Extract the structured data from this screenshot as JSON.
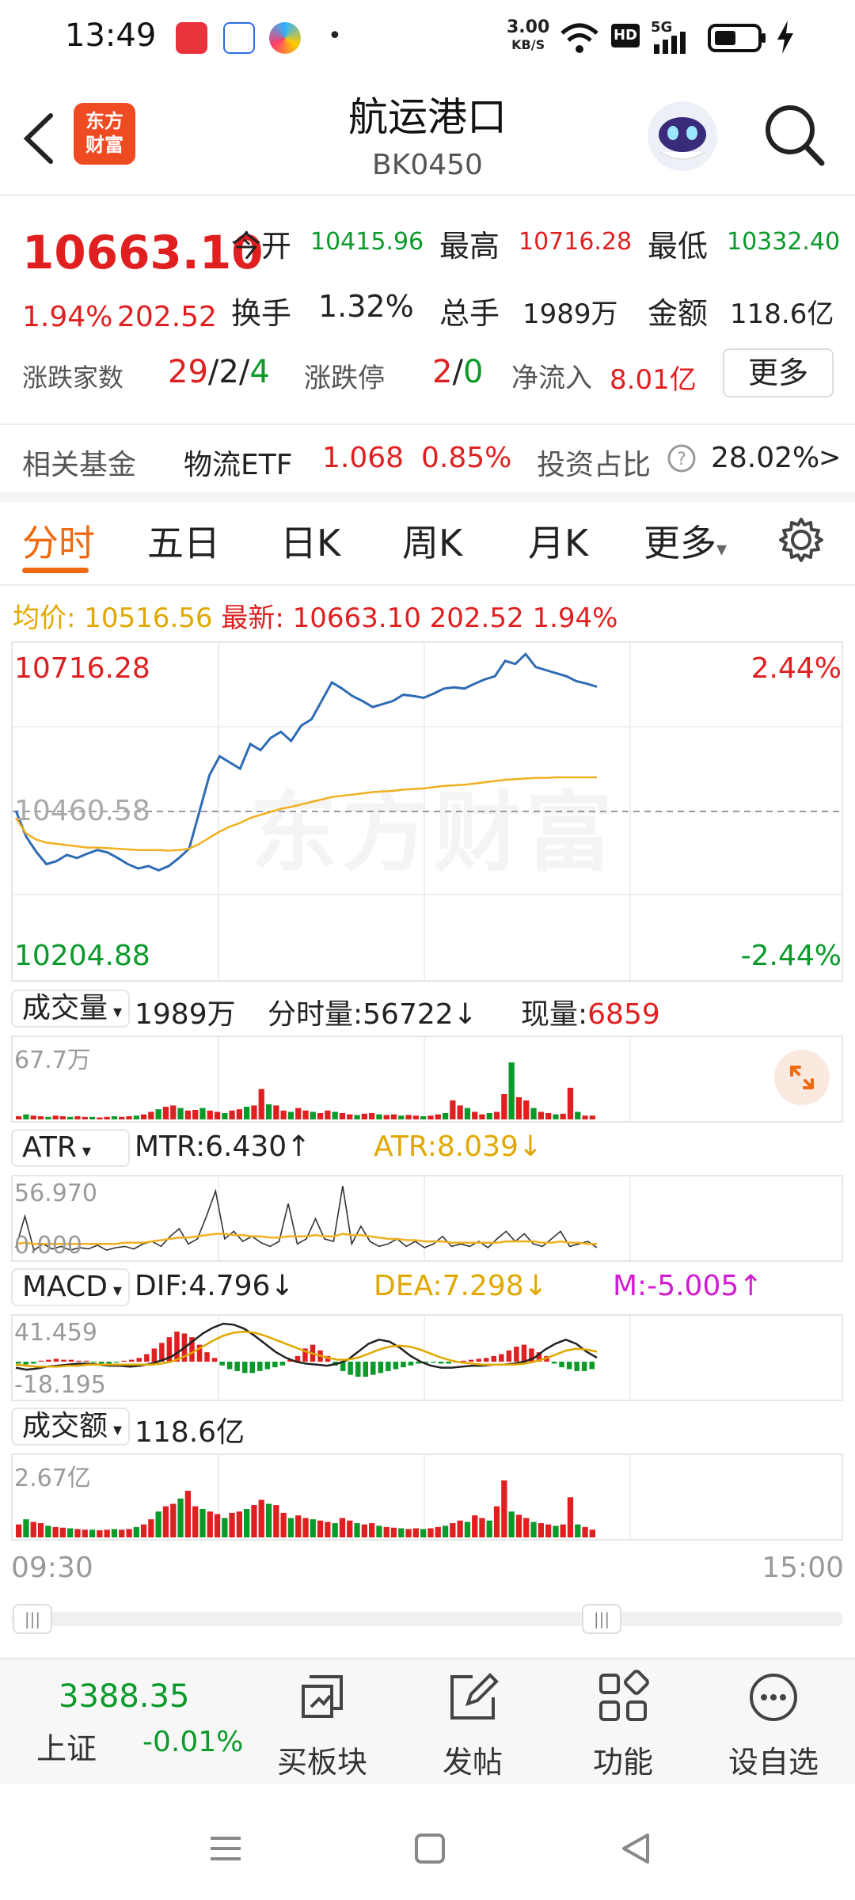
{
  "status_bar": {
    "time": "13:49",
    "net_speed_value": "3.00",
    "net_speed_unit": "KB/S",
    "hd": "HD",
    "cell": "5G",
    "dot": "•"
  },
  "header": {
    "back_icon": "chevron-left-icon",
    "logo_line1": "东方",
    "logo_line2": "财富",
    "title": "航运港口",
    "code": "BK0450",
    "search_icon": "search-icon",
    "assistant_icon": "robot-avatar-icon"
  },
  "quote": {
    "price": "10663.10",
    "change_pct": "1.94%",
    "change": "202.52",
    "open_label": "今开",
    "open": "10415.96",
    "high_label": "最高",
    "high": "10716.28",
    "low_label": "最低",
    "low": "10332.40",
    "turnover_label": "换手",
    "turnover": "1.32%",
    "volume_label": "总手",
    "volume": "1989万",
    "amount_label": "金额",
    "amount": "118.6亿",
    "breadth_label": "涨跌家数",
    "up": "29",
    "flat": "2",
    "down": "4",
    "slash": "/",
    "limit_label": "涨跌停",
    "limit_up": "2",
    "limit_down": "0",
    "inflow_label": "净流入",
    "inflow": "8.01亿",
    "more_label": "更多"
  },
  "fund": {
    "label": "相关基金",
    "name": "物流ETF",
    "price": "1.068",
    "pct": "0.85%",
    "ratio_label": "投资占比",
    "ratio": "28.02%",
    "arrow": ">",
    "help_icon": "question-circle-icon"
  },
  "tabs": [
    {
      "label": "分时",
      "active": true
    },
    {
      "label": "五日"
    },
    {
      "label": "日K"
    },
    {
      "label": "周K"
    },
    {
      "label": "月K"
    },
    {
      "label": "更多"
    }
  ],
  "tab_more_arrow": "▾",
  "settings_icon": "gear-icon",
  "info_line": {
    "avg_label": "均价:",
    "avg": "10516.56",
    "latest_label": "最新:",
    "latest": "10663.10",
    "chg": "202.52",
    "pct": "1.94%"
  },
  "chart_data": [
    {
      "type": "line",
      "name": "intraday-price",
      "ylim": [
        10204.88,
        10716.28
      ],
      "ref": 10460.58,
      "y_top_label": "10716.28",
      "y_mid_label": "10460.58",
      "y_bottom_label": "10204.88",
      "pct_top": "2.44%",
      "pct_bottom": "-2.44%",
      "series": [
        {
          "values": [
            10462,
            10420,
            10395,
            10375,
            10380,
            10390,
            10385,
            10392,
            10398,
            10394,
            10385,
            10375,
            10368,
            10372,
            10365,
            10372,
            10385,
            10400,
            10460,
            10520,
            10550,
            10540,
            10530,
            10570,
            10560,
            10580,
            10590,
            10575,
            10600,
            10610,
            10640,
            10670,
            10660,
            10648,
            10640,
            10630,
            10635,
            10640,
            10650,
            10648,
            10645,
            10652,
            10660,
            10662,
            10660,
            10668,
            10675,
            10680,
            10705,
            10700,
            10716,
            10695,
            10690,
            10685,
            10680,
            10672,
            10668,
            10663
          ]
        },
        {
          "values": [
            10450,
            10425,
            10415,
            10410,
            10408,
            10406,
            10404,
            10402,
            10402,
            10401,
            10400,
            10399,
            10398,
            10398,
            10398,
            10397,
            10398,
            10400,
            10408,
            10418,
            10428,
            10436,
            10442,
            10450,
            10455,
            10460,
            10465,
            10468,
            10472,
            10476,
            10480,
            10484,
            10486,
            10488,
            10490,
            10492,
            10493,
            10494,
            10496,
            10497,
            10498,
            10500,
            10502,
            10503,
            10504,
            10506,
            10508,
            10510,
            10512,
            10513,
            10514,
            10515,
            10515,
            10516,
            10516,
            10516,
            10516,
            10516
          ]
        }
      ]
    },
    {
      "type": "bar",
      "name": "volume",
      "y_label": "67.7万",
      "panel_label": "成交量",
      "value": "1989万",
      "tick_label": "分时量:",
      "tick": "56722",
      "tick_arrow": "↓",
      "now_label": "现量:",
      "now": "6859",
      "values": [
        5,
        8,
        6,
        5,
        4,
        6,
        5,
        4,
        5,
        4,
        4,
        3,
        4,
        5,
        4,
        5,
        6,
        8,
        12,
        16,
        20,
        22,
        18,
        14,
        15,
        18,
        14,
        12,
        10,
        14,
        16,
        20,
        22,
        48,
        24,
        22,
        14,
        12,
        18,
        14,
        12,
        10,
        14,
        12,
        10,
        8,
        7,
        9,
        10,
        8,
        7,
        8,
        6,
        7,
        6,
        5,
        6,
        8,
        10,
        30,
        22,
        18,
        12,
        8,
        10,
        12,
        40,
        90,
        35,
        30,
        18,
        12,
        10,
        8,
        9,
        50,
        12,
        6,
        6
      ]
    },
    {
      "type": "line",
      "name": "atr",
      "y_label": "56.970",
      "y_label_low": "0.000",
      "panel_label": "ATR",
      "mtr_label": "MTR:",
      "mtr": "6.430",
      "mtr_arrow": "↑",
      "atr_label": "ATR:",
      "atr": "8.039",
      "atr_arrow": "↓",
      "series": [
        {
          "values": [
            5,
            30,
            3,
            8,
            4,
            6,
            3,
            5,
            4,
            7,
            3,
            5,
            6,
            4,
            8,
            10,
            6,
            14,
            20,
            8,
            12,
            30,
            50,
            12,
            18,
            10,
            14,
            9,
            6,
            10,
            40,
            8,
            12,
            28,
            12,
            10,
            54,
            8,
            22,
            10,
            6,
            8,
            12,
            6,
            10,
            5,
            8,
            14,
            6,
            8,
            6,
            10,
            5,
            12,
            18,
            10,
            16,
            8,
            6,
            12,
            18,
            6,
            8,
            10,
            5
          ]
        },
        {
          "values": [
            8,
            9,
            8,
            8,
            8,
            8,
            8,
            8,
            8,
            8,
            8,
            8,
            9,
            9,
            9,
            10,
            11,
            12,
            13,
            13,
            14,
            15,
            16,
            16,
            15,
            15,
            14,
            14,
            13,
            13,
            14,
            14,
            14,
            15,
            14,
            14,
            16,
            15,
            15,
            14,
            13,
            12,
            12,
            11,
            11,
            10,
            10,
            10,
            9,
            9,
            9,
            9,
            9,
            9,
            10,
            10,
            10,
            10,
            9,
            9,
            10,
            9,
            9,
            8,
            8
          ]
        }
      ]
    },
    {
      "type": "bar",
      "name": "macd",
      "y_label": "41.459",
      "y_label_low": "-18.195",
      "panel_label": "MACD",
      "dif_label": "DIF:",
      "dif": "4.796",
      "dif_arrow": "↓",
      "dea_label": "DEA:",
      "dea": "7.298",
      "dea_arrow": "↓",
      "m_label": "M:",
      "m": "-5.005",
      "m_arrow": "↑",
      "values": [
        -2,
        -3,
        -2,
        1,
        2,
        3,
        2,
        2,
        1,
        1,
        -1,
        -2,
        -2,
        -1,
        1,
        2,
        4,
        8,
        14,
        20,
        26,
        32,
        30,
        26,
        18,
        10,
        4,
        -4,
        -8,
        -10,
        -12,
        -12,
        -10,
        -8,
        -6,
        -4,
        2,
        6,
        14,
        18,
        12,
        6,
        -4,
        -10,
        -14,
        -16,
        -16,
        -14,
        -12,
        -10,
        -8,
        -6,
        -4,
        -2,
        -1,
        -1,
        -2,
        -2,
        -1,
        1,
        2,
        3,
        4,
        6,
        8,
        12,
        16,
        18,
        14,
        10,
        6,
        -2,
        -6,
        -8,
        -10,
        -10,
        -8
      ],
      "series": [
        {
          "values": [
            -6,
            -8,
            -7,
            -5,
            -4,
            -3,
            -2,
            -2,
            -3,
            -4,
            -4,
            -5,
            -4,
            -2,
            1,
            5,
            12,
            20,
            28,
            34,
            38,
            37,
            33,
            26,
            18,
            10,
            4,
            0,
            -2,
            -3,
            -4,
            -2,
            2,
            10,
            18,
            22,
            20,
            14,
            6,
            0,
            -4,
            -6,
            -6,
            -5,
            -4,
            -4,
            -3,
            -3,
            -2,
            0,
            4,
            12,
            18,
            22,
            18,
            10,
            4
          ]
        },
        {
          "values": [
            -3,
            -4,
            -5,
            -5,
            -5,
            -4,
            -4,
            -3,
            -3,
            -3,
            -3,
            -3,
            -3,
            -3,
            -2,
            0,
            4,
            9,
            15,
            21,
            26,
            29,
            30,
            29,
            26,
            22,
            18,
            14,
            10,
            7,
            4,
            2,
            2,
            4,
            8,
            12,
            15,
            16,
            15,
            12,
            8,
            4,
            1,
            -1,
            -2,
            -3,
            -3,
            -3,
            -3,
            -2,
            0,
            3,
            7,
            11,
            13,
            12,
            10
          ]
        }
      ]
    },
    {
      "type": "bar",
      "name": "amount",
      "y_label": "2.67亿",
      "panel_label": "成交额",
      "value": "118.6亿",
      "values": [
        20,
        28,
        24,
        22,
        18,
        16,
        15,
        14,
        13,
        12,
        12,
        11,
        12,
        13,
        12,
        13,
        16,
        20,
        28,
        40,
        48,
        52,
        60,
        72,
        48,
        44,
        40,
        36,
        30,
        38,
        40,
        44,
        50,
        58,
        52,
        50,
        38,
        30,
        34,
        30,
        28,
        26,
        24,
        22,
        30,
        26,
        22,
        20,
        22,
        18,
        16,
        15,
        14,
        13,
        14,
        13,
        14,
        16,
        18,
        22,
        26,
        24,
        34,
        30,
        26,
        48,
        88,
        40,
        35,
        30,
        24,
        22,
        20,
        18,
        20,
        62,
        20,
        16,
        12
      ]
    }
  ],
  "time_axis": {
    "start": "09:30",
    "end": "15:00"
  },
  "watermark": "东方财富",
  "expand_icon": "expand-icon",
  "bottom_nav": {
    "index_value": "3388.35",
    "index_name": "上证",
    "index_pct": "-0.01%",
    "items": [
      {
        "label": "买板块",
        "icon": "buy-block-icon"
      },
      {
        "label": "发帖",
        "icon": "edit-post-icon"
      },
      {
        "label": "功能",
        "icon": "apps-grid-icon"
      },
      {
        "label": "设自选",
        "icon": "more-circle-icon"
      }
    ]
  },
  "system_nav": {
    "menu_icon": "menu-icon",
    "home_icon": "home-square-icon",
    "back_icon": "back-triangle-icon"
  },
  "colors": {
    "up": "#e02020",
    "down": "#0a9a2a",
    "accent": "#ef6a10",
    "price_line": "#2f6bb4",
    "avg_line": "#f0b020",
    "dea": "#e0a800",
    "m": "#d21bd2"
  }
}
